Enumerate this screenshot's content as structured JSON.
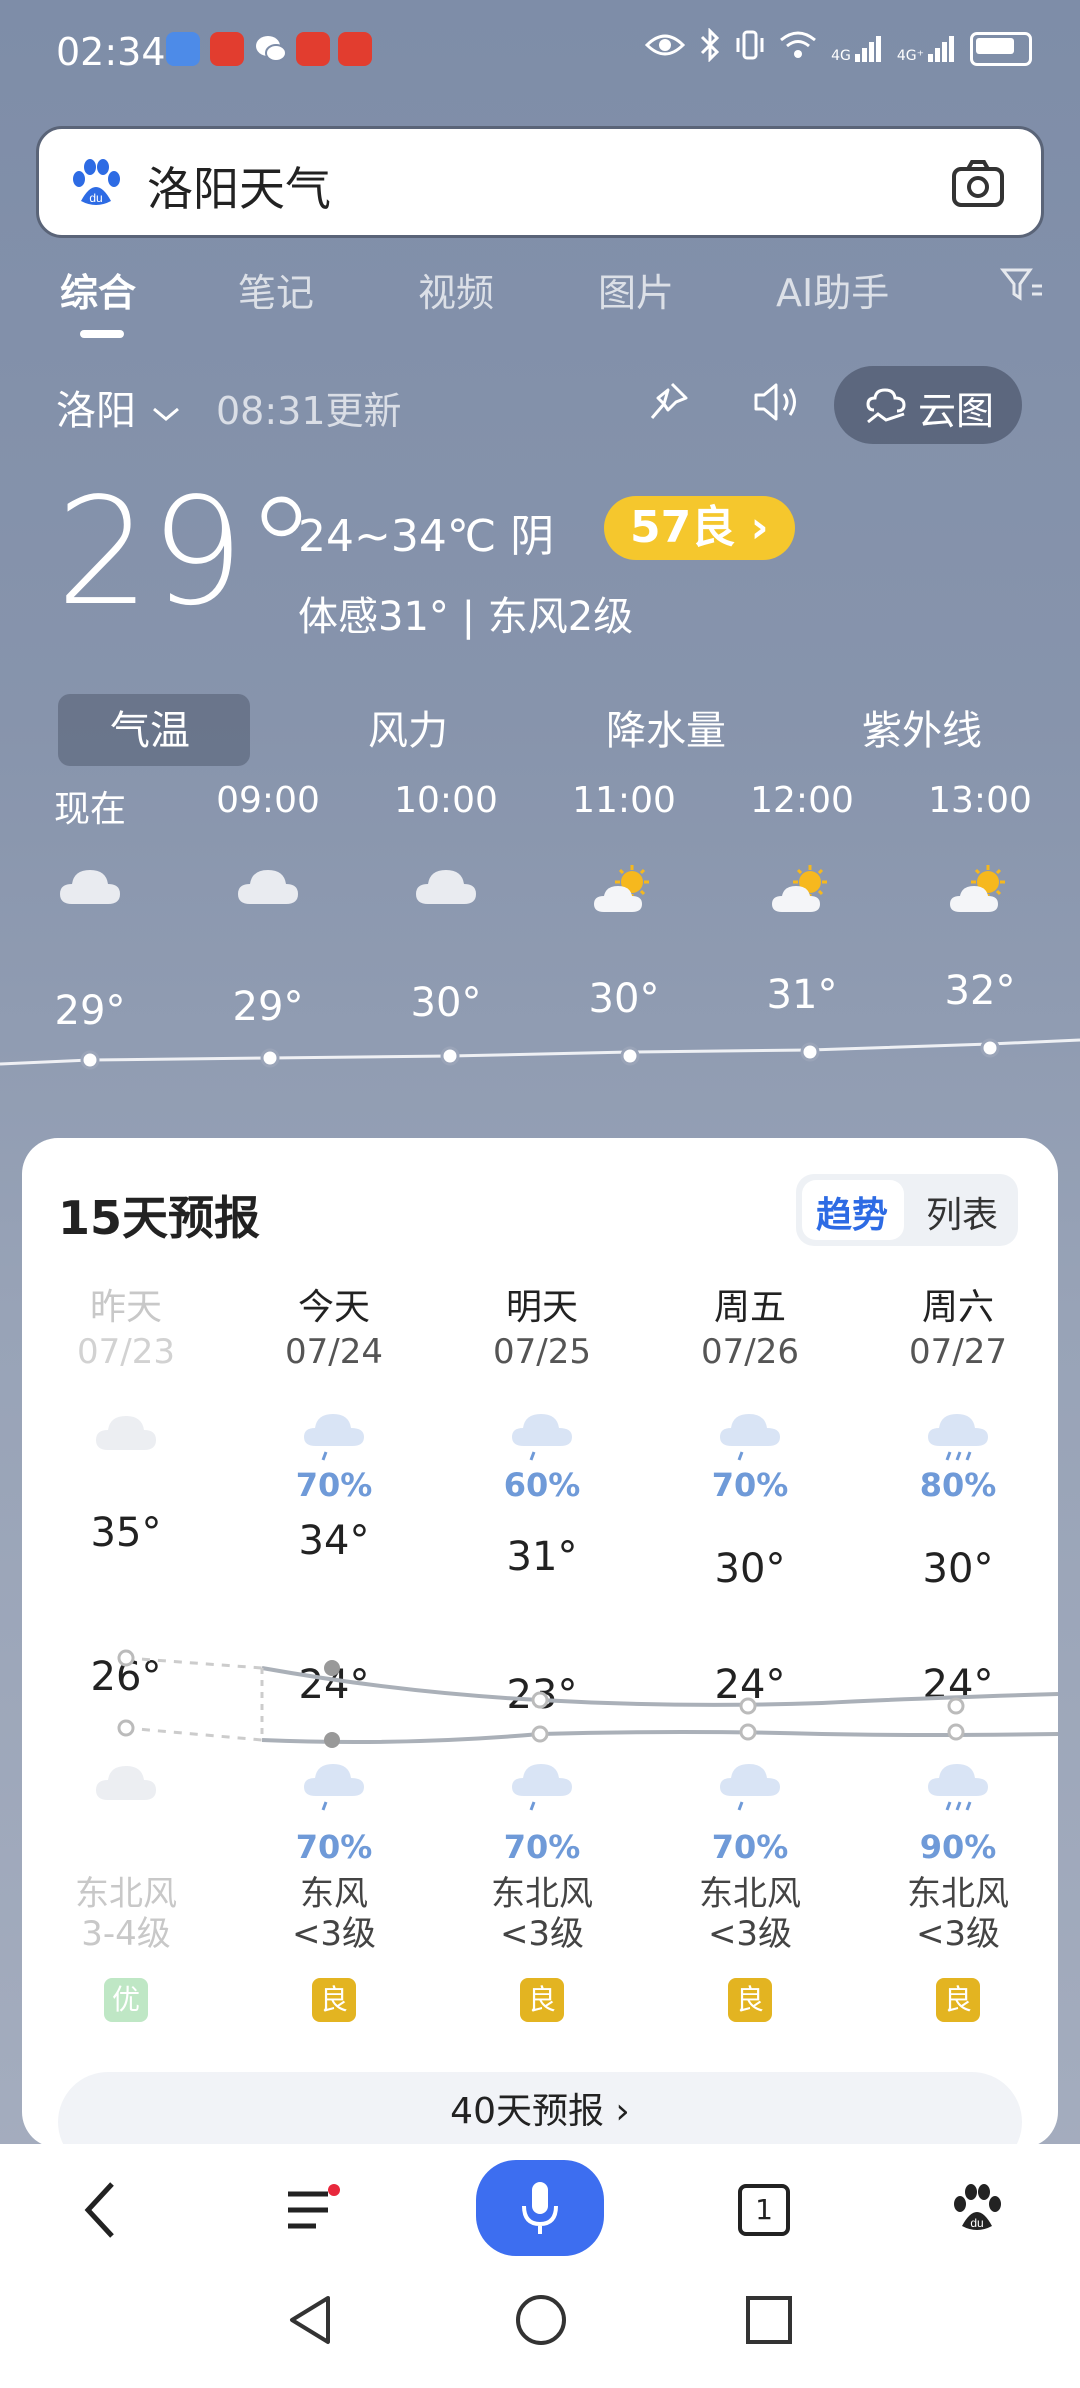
{
  "status_bar": {
    "time": "02:34",
    "sig1": "4G",
    "sig2": "4G⁺"
  },
  "search": {
    "query": "洛阳天气"
  },
  "tabs": [
    "综合",
    "笔记",
    "视频",
    "图片",
    "AI助手"
  ],
  "location": {
    "city": "洛阳",
    "updated": "08:31更新",
    "cloud_map": "云图"
  },
  "current": {
    "temp": "29°",
    "range_desc": "24~34℃ 阴",
    "aqi": "57良 ›",
    "feels": "体感31° | 东风2级"
  },
  "hourly_tabs": [
    "气温",
    "风力",
    "降水量",
    "紫外线"
  ],
  "hourly": [
    {
      "time": "现在",
      "temp": "29°",
      "icon": "cloud-icon"
    },
    {
      "time": "09:00",
      "temp": "29°",
      "icon": "cloud-icon"
    },
    {
      "time": "10:00",
      "temp": "30°",
      "icon": "cloud-icon"
    },
    {
      "time": "11:00",
      "temp": "30°",
      "icon": "sun-cloud-icon"
    },
    {
      "time": "12:00",
      "temp": "31°",
      "icon": "sun-cloud-icon"
    },
    {
      "time": "13:00",
      "temp": "32°",
      "icon": "sun-cloud-icon"
    }
  ],
  "forecast": {
    "title": "15天预报",
    "toggle": [
      "趋势",
      "列表"
    ],
    "days": [
      {
        "name": "昨天",
        "date": "07/23",
        "day_pct": "",
        "high": "35°",
        "low": "26°",
        "night_pct": "",
        "wind": "东北风",
        "wind_level": "3-4级",
        "aqi": "优",
        "past": true
      },
      {
        "name": "今天",
        "date": "07/24",
        "day_pct": "70%",
        "high": "34°",
        "low": "24°",
        "night_pct": "70%",
        "wind": "东风",
        "wind_level": "<3级",
        "aqi": "良",
        "past": false
      },
      {
        "name": "明天",
        "date": "07/25",
        "day_pct": "60%",
        "high": "31°",
        "low": "23°",
        "night_pct": "70%",
        "wind": "东北风",
        "wind_level": "<3级",
        "aqi": "良",
        "past": false
      },
      {
        "name": "周五",
        "date": "07/26",
        "day_pct": "70%",
        "high": "30°",
        "low": "24°",
        "night_pct": "70%",
        "wind": "东北风",
        "wind_level": "<3级",
        "aqi": "良",
        "past": false
      },
      {
        "name": "周六",
        "date": "07/27",
        "day_pct": "80%",
        "high": "30°",
        "low": "24°",
        "night_pct": "90%",
        "wind": "东北风",
        "wind_level": "<3级",
        "aqi": "良",
        "past": false
      }
    ],
    "more": "40天预报 ›"
  },
  "bottom_nav": {
    "tab_count": "1"
  },
  "colors": {
    "accent": "#3d6ef0",
    "aqi_good": "#f5c72d",
    "aqi_excellent": "#bfe7c5",
    "rain": "#6f9ad8"
  }
}
